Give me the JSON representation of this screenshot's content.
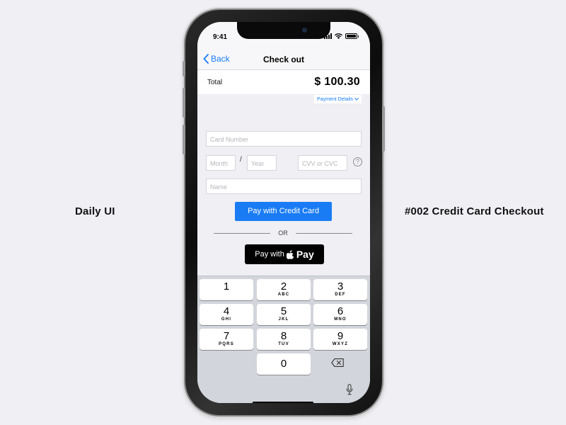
{
  "captions": {
    "left": "Daily UI",
    "right": "#002 Credit Card Checkout"
  },
  "status": {
    "time": "9:41"
  },
  "nav": {
    "back_label": "Back",
    "title": "Check out"
  },
  "summary": {
    "total_label": "Total",
    "total_amount": "$ 100.30",
    "details_link": "Payment Details"
  },
  "form": {
    "card_number_placeholder": "Card Number",
    "month_placeholder": "Month",
    "separator": "/",
    "year_placeholder": "Year",
    "cvv_placeholder": "CVV or CVC",
    "help": "?",
    "name_placeholder": "Name"
  },
  "actions": {
    "pay_credit": "Pay with Credit Card",
    "or": "OR",
    "apple_pay_prefix": "Pay with",
    "apple_pay_brand": "Pay"
  },
  "keypad": {
    "keys": [
      {
        "num": "1",
        "letters": ""
      },
      {
        "num": "2",
        "letters": "ABC"
      },
      {
        "num": "3",
        "letters": "DEF"
      },
      {
        "num": "4",
        "letters": "GHI"
      },
      {
        "num": "5",
        "letters": "JKL"
      },
      {
        "num": "6",
        "letters": "MNO"
      },
      {
        "num": "7",
        "letters": "PQRS"
      },
      {
        "num": "8",
        "letters": "TUV"
      },
      {
        "num": "9",
        "letters": "WXYZ"
      },
      {
        "num": "0",
        "letters": ""
      }
    ]
  },
  "colors": {
    "accent": "#1a7cf5",
    "background": "#efeff4",
    "keyboard": "#d2d5db"
  }
}
